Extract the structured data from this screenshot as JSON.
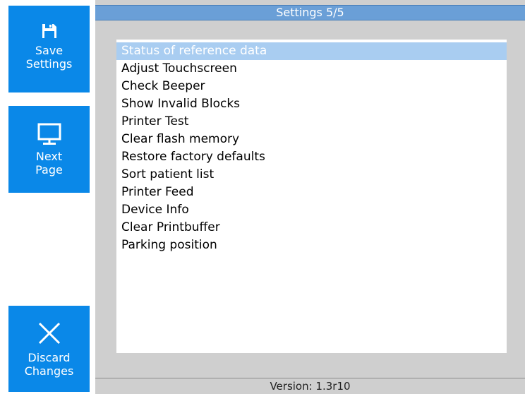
{
  "sidebar": {
    "save": {
      "line1": "Save",
      "line2": "Settings",
      "icon": "save-icon"
    },
    "next": {
      "line1": "Next",
      "line2": "Page",
      "icon": "monitor-icon"
    },
    "discard": {
      "line1": "Discard",
      "line2": "Changes",
      "icon": "close-icon"
    }
  },
  "header": {
    "title": "Settings 5/5"
  },
  "menu": {
    "items": [
      "Status of reference data",
      "Adjust Touchscreen",
      "Check Beeper",
      "Show Invalid Blocks",
      "Printer Test",
      "Clear flash memory",
      "Restore factory defaults",
      "Sort patient list",
      "Printer Feed",
      "Device Info",
      "Clear Printbuffer",
      "Parking position"
    ],
    "selected_index": 0
  },
  "footer": {
    "version": "Version: 1.3r10"
  },
  "colors": {
    "button_blue": "#0a88e8",
    "title_blue": "#6a9fd7",
    "selection": "#a9cdf1",
    "panel_gray": "#cfcfcf"
  }
}
